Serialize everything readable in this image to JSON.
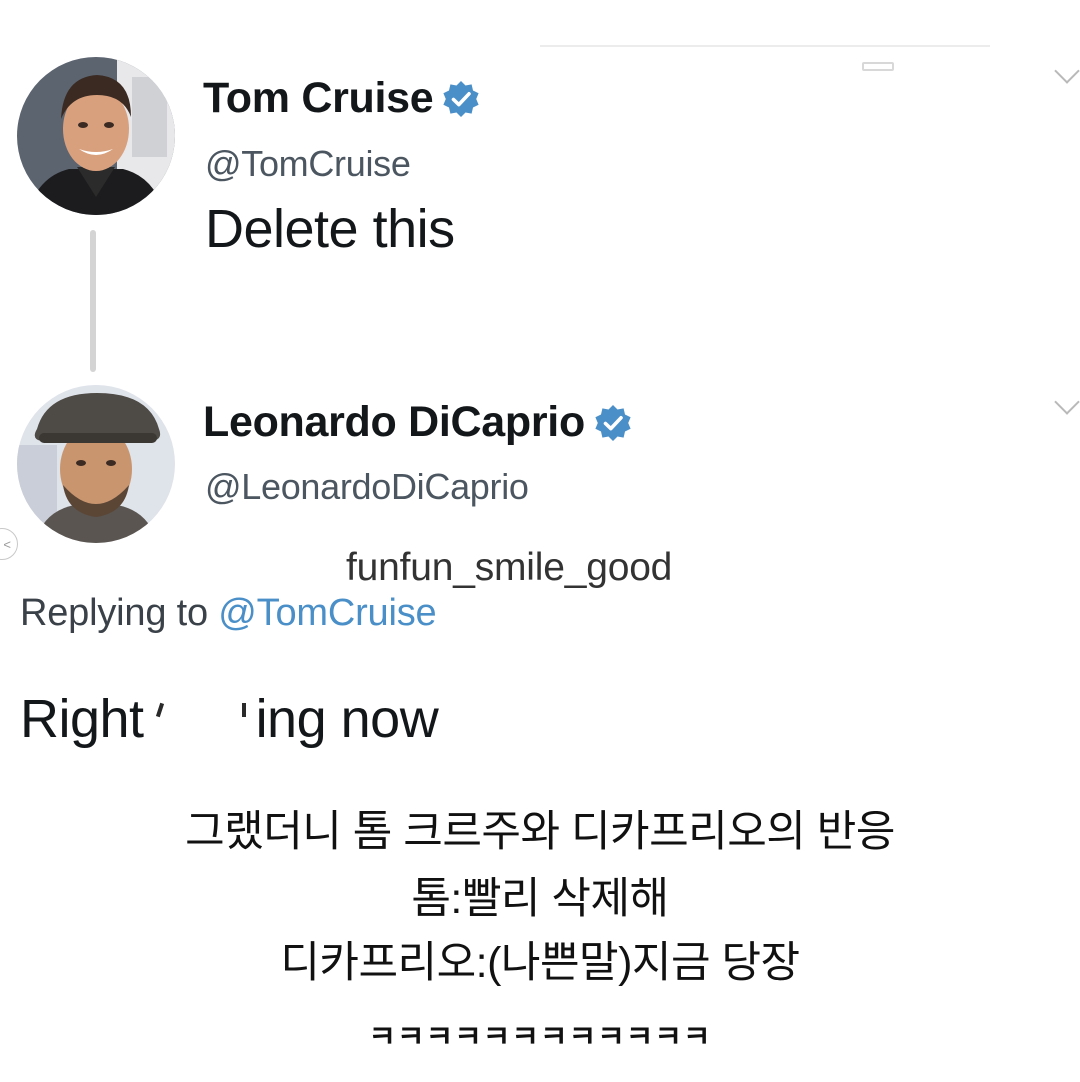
{
  "tweets": [
    {
      "display_name": "Tom Cruise",
      "handle": "@TomCruise",
      "text": "Delete this",
      "verified": true,
      "avatar": "avatar-photo"
    },
    {
      "display_name": "Leonardo DiCaprio",
      "handle": "@LeonardoDiCaprio",
      "replying_prefix": "Replying to",
      "replying_to": "@TomCruise",
      "text_before": "Right",
      "text_after": "ing now",
      "verified": true,
      "avatar": "avatar-photo"
    }
  ],
  "watermark": "funfun_smile_good",
  "caption": {
    "line1": "그랬더니 톰 크르주와 디카프리오의 반응",
    "line2": "톰:빨리 삭제해",
    "line3": "디카프리오:(나쁜말)지금 당장",
    "laugh": "ㅋㅋㅋㅋㅋㅋㅋㅋㅋㅋㅋㅋ"
  },
  "icons": {
    "verified": "verified-badge-icon",
    "more": "chevron-down-icon",
    "window": "minimize-icon",
    "nav": "chevron-left-icon"
  },
  "colors": {
    "verified_blue": "#4a8fc8",
    "mention_blue": "#4a8fc8",
    "text": "#14171a",
    "secondary": "#4b5660"
  }
}
